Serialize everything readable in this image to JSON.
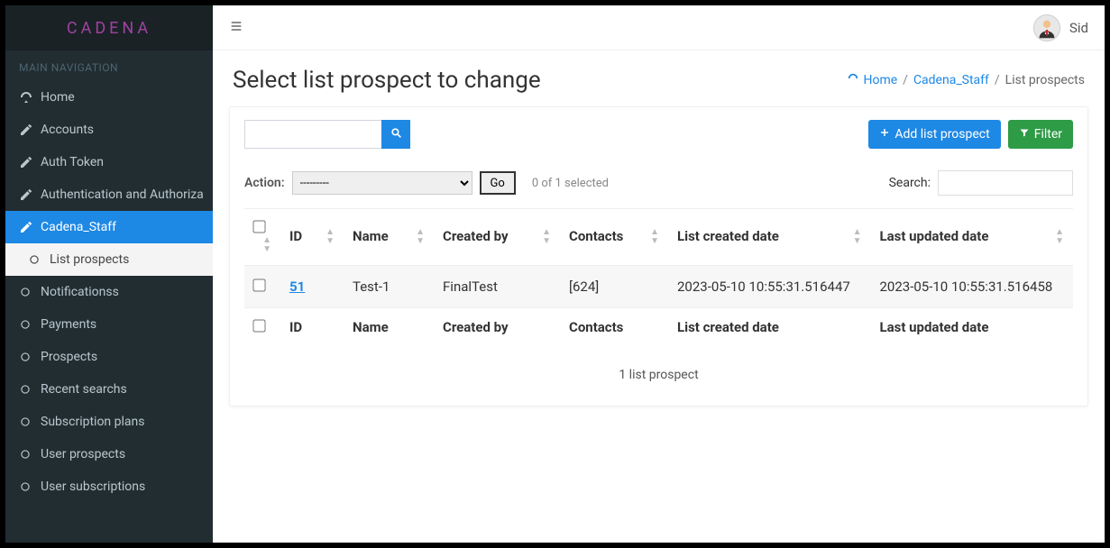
{
  "brand": "CADENA",
  "nav_header": "MAIN NAVIGATION",
  "sidebar": {
    "items": [
      {
        "label": "Home",
        "icon": "dashboard"
      },
      {
        "label": "Accounts",
        "icon": "edit"
      },
      {
        "label": "Auth Token",
        "icon": "edit"
      },
      {
        "label": "Authentication and Authoriza",
        "icon": "edit"
      },
      {
        "label": "Cadena_Staff",
        "icon": "edit",
        "active": true
      },
      {
        "label": "List prospects",
        "icon": "circle",
        "sub": true
      },
      {
        "label": "Notificationss",
        "icon": "circle"
      },
      {
        "label": "Payments",
        "icon": "circle"
      },
      {
        "label": "Prospects",
        "icon": "circle"
      },
      {
        "label": "Recent searchs",
        "icon": "circle"
      },
      {
        "label": "Subscription plans",
        "icon": "circle"
      },
      {
        "label": "User prospects",
        "icon": "circle"
      },
      {
        "label": "User subscriptions",
        "icon": "circle"
      }
    ]
  },
  "user_name": "Sid",
  "page_title": "Select list prospect to change",
  "breadcrumb": {
    "home": "Home",
    "mid": "Cadena_Staff",
    "current": "List prospects"
  },
  "buttons": {
    "add": "Add list prospect",
    "filter": "Filter"
  },
  "action": {
    "label": "Action:",
    "placeholder": "---------",
    "go": "Go",
    "selected": "0 of 1 selected"
  },
  "table_search_label": "Search:",
  "columns": [
    "",
    "ID",
    "Name",
    "Created by",
    "Contacts",
    "List created date",
    "Last updated date"
  ],
  "rows": [
    {
      "id": "51",
      "name": "Test-1",
      "created_by": "FinalTest",
      "contacts": "[624]",
      "created": "2023-05-10 10:55:31.516447",
      "updated": "2023-05-10 10:55:31.516458"
    }
  ],
  "footer_count": "1 list prospect"
}
